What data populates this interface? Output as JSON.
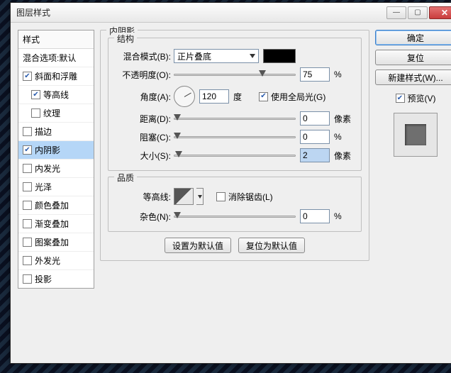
{
  "window": {
    "title": "图层样式"
  },
  "left": {
    "styles_header": "样式",
    "blend_header": "混合选项:默认",
    "items": [
      {
        "label": "斜面和浮雕",
        "checked": true,
        "sub": false
      },
      {
        "label": "等高线",
        "checked": true,
        "sub": true
      },
      {
        "label": "纹理",
        "checked": false,
        "sub": true
      },
      {
        "label": "描边",
        "checked": false,
        "sub": false
      },
      {
        "label": "内阴影",
        "checked": true,
        "sub": false,
        "selected": true
      },
      {
        "label": "内发光",
        "checked": false,
        "sub": false
      },
      {
        "label": "光泽",
        "checked": false,
        "sub": false
      },
      {
        "label": "颜色叠加",
        "checked": false,
        "sub": false
      },
      {
        "label": "渐变叠加",
        "checked": false,
        "sub": false
      },
      {
        "label": "图案叠加",
        "checked": false,
        "sub": false
      },
      {
        "label": "外发光",
        "checked": false,
        "sub": false
      },
      {
        "label": "投影",
        "checked": false,
        "sub": false
      }
    ]
  },
  "panel": {
    "title": "内阴影",
    "structure": {
      "legend": "结构",
      "blend_mode_label": "混合模式(B):",
      "blend_mode_value": "正片叠底",
      "color": "#000000",
      "opacity_label": "不透明度(O):",
      "opacity_value": "75",
      "opacity_unit": "%",
      "angle_label": "角度(A):",
      "angle_value": "120",
      "angle_unit": "度",
      "global_label": "使用全局光(G)",
      "global_checked": true,
      "distance_label": "距离(D):",
      "distance_value": "0",
      "distance_unit": "像素",
      "choke_label": "阻塞(C):",
      "choke_value": "0",
      "choke_unit": "%",
      "size_label": "大小(S):",
      "size_value": "2",
      "size_unit": "像素"
    },
    "quality": {
      "legend": "品质",
      "contour_label": "等高线:",
      "antialias_label": "消除锯齿(L)",
      "antialias_checked": false,
      "noise_label": "杂色(N):",
      "noise_value": "0",
      "noise_unit": "%"
    },
    "buttons": {
      "default": "设置为默认值",
      "reset": "复位为默认值"
    }
  },
  "right": {
    "ok": "确定",
    "cancel": "复位",
    "new_style": "新建样式(W)...",
    "preview_label": "预览(V)",
    "preview_checked": true
  }
}
